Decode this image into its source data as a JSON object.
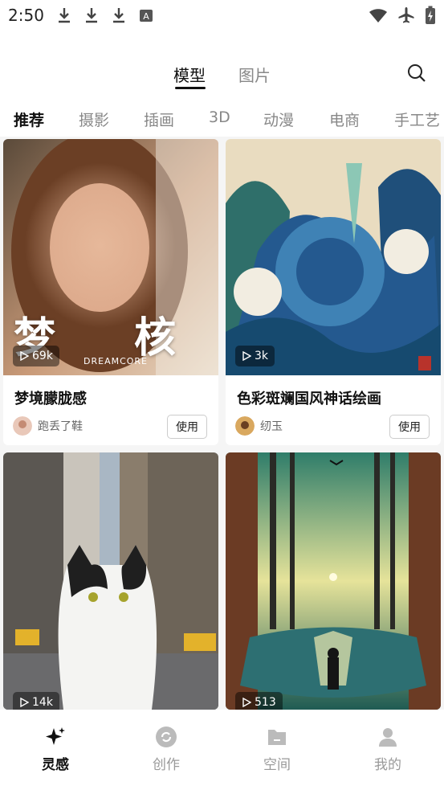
{
  "status_bar": {
    "time": "2:50"
  },
  "header": {
    "tabs": [
      {
        "label": "模型",
        "active": true
      },
      {
        "label": "图片",
        "active": false
      }
    ],
    "search_icon": "search-icon"
  },
  "categories": [
    "推荐",
    "摄影",
    "插画",
    "3D",
    "动漫",
    "电商",
    "手工艺"
  ],
  "cards": [
    {
      "plays": "69k",
      "overlay_title": "梦 核",
      "overlay_sub": "DREAMCORE",
      "title": "梦境朦胧感",
      "author": "跑丢了鞋",
      "use_label": "使用"
    },
    {
      "plays": "3k",
      "title": "色彩斑斓国风神话绘画",
      "author": "纫玉",
      "use_label": "使用"
    },
    {
      "plays": "14k"
    },
    {
      "plays": "513"
    }
  ],
  "bottom_nav": [
    {
      "label": "灵感",
      "icon": "sparkle-icon",
      "active": true
    },
    {
      "label": "创作",
      "icon": "create-icon",
      "active": false
    },
    {
      "label": "空间",
      "icon": "folder-icon",
      "active": false
    },
    {
      "label": "我的",
      "icon": "profile-icon",
      "active": false
    }
  ],
  "colors": {
    "accent": "#111111",
    "inactive": "#999999"
  }
}
